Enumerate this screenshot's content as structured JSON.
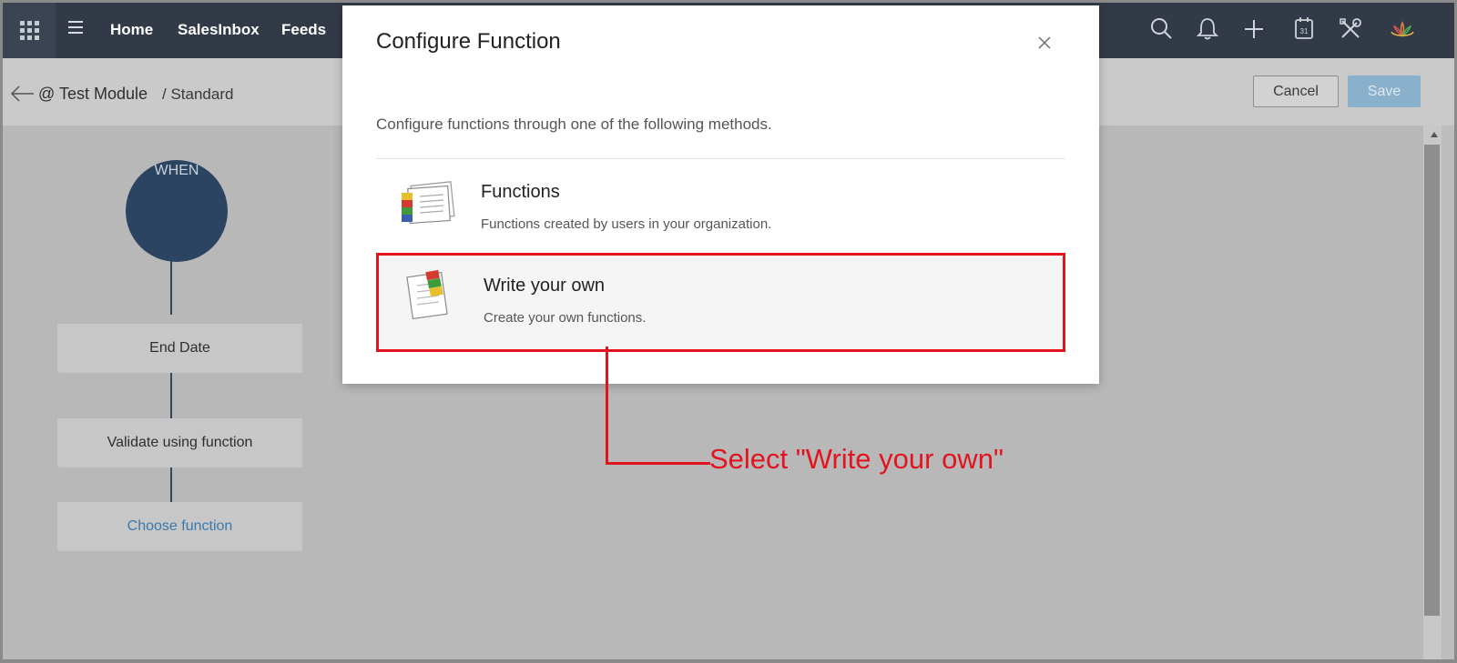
{
  "nav": {
    "items": [
      "Home",
      "SalesInbox",
      "Feeds"
    ],
    "icons": [
      "apps-grid-icon",
      "menu-icon",
      "search-icon",
      "bell-icon",
      "plus-icon",
      "calendar-icon",
      "tools-icon",
      "logo-icon"
    ],
    "calendar_day": "31"
  },
  "breadcrumb": {
    "module": "@ Test Module",
    "layout": "/ Standard"
  },
  "actions": {
    "cancel": "Cancel",
    "save": "Save"
  },
  "flow": {
    "when": "WHEN",
    "steps": [
      "End Date",
      "Validate using function",
      "Choose function"
    ]
  },
  "modal": {
    "title": "Configure Function",
    "description": "Configure functions through one of the following methods.",
    "options": [
      {
        "title": "Functions",
        "subtitle": "Functions created by users in your organization."
      },
      {
        "title": "Write your own",
        "subtitle": "Create your own functions."
      }
    ]
  },
  "annotation": {
    "text": "Select \"Write your own\"",
    "color": "#e3131f"
  },
  "colors": {
    "nav_bg": "#323a48",
    "when_node": "#2b4461",
    "link": "#3b78ad",
    "save_disabled": "#8ab1cc"
  }
}
